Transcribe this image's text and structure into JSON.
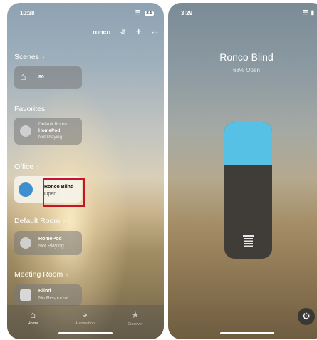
{
  "left": {
    "status": {
      "time": "10:38",
      "battery": "84"
    },
    "topbar": {
      "home_name": "ronco",
      "icons": [
        "waveform-icon",
        "plus-icon",
        "more-icon"
      ]
    },
    "scenes": {
      "title": "Scenes",
      "tile": {
        "label": "80"
      }
    },
    "favorites": {
      "title": "Favorites",
      "tile": {
        "room": "Default Room",
        "name": "HomePod",
        "state": "Not Playing"
      }
    },
    "office": {
      "title": "Office",
      "tile": {
        "name": "Ronco Blind",
        "state": "Open"
      }
    },
    "default_room": {
      "title": "Default Room",
      "tile": {
        "name": "HomePod",
        "state": "Not Playing"
      }
    },
    "meeting_room": {
      "title": "Meeting Room",
      "tile": {
        "name": "Blind",
        "state": "No Response"
      }
    },
    "tabs": {
      "home": "Home",
      "automation": "Automation",
      "discover": "Discover"
    }
  },
  "right": {
    "status": {
      "time": "3:29"
    },
    "title": "Ronco Blind",
    "subtitle": "68% Open",
    "open_percent": 68
  }
}
